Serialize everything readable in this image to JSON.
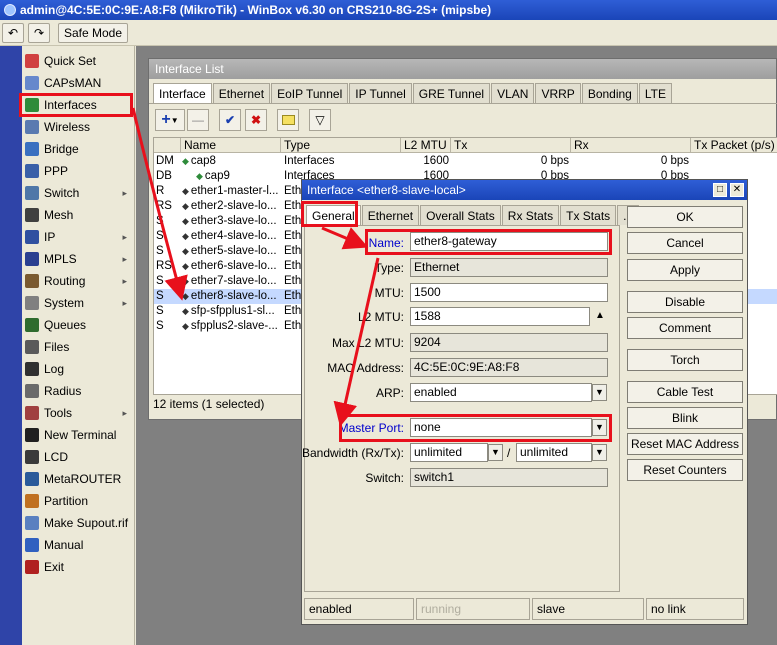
{
  "title_bar": {
    "text": "admin@4C:5E:0C:9E:A8:F8 (MikroTik) - WinBox v6.30 on CRS210-8G-2S+ (mipsbe)"
  },
  "toolbar": {
    "safe_mode": "Safe Mode"
  },
  "sidebar": {
    "items": [
      {
        "label": "Quick Set",
        "icon": "quick-set-icon"
      },
      {
        "label": "CAPsMAN",
        "icon": "capsman-icon"
      },
      {
        "label": "Interfaces",
        "icon": "interfaces-icon"
      },
      {
        "label": "Wireless",
        "icon": "wireless-icon"
      },
      {
        "label": "Bridge",
        "icon": "bridge-icon"
      },
      {
        "label": "PPP",
        "icon": "ppp-icon"
      },
      {
        "label": "Switch",
        "icon": "switch-icon",
        "submenu": true
      },
      {
        "label": "Mesh",
        "icon": "mesh-icon"
      },
      {
        "label": "IP",
        "icon": "ip-icon",
        "submenu": true
      },
      {
        "label": "MPLS",
        "icon": "mpls-icon",
        "submenu": true
      },
      {
        "label": "Routing",
        "icon": "routing-icon",
        "submenu": true
      },
      {
        "label": "System",
        "icon": "system-icon",
        "submenu": true
      },
      {
        "label": "Queues",
        "icon": "queues-icon"
      },
      {
        "label": "Files",
        "icon": "files-icon"
      },
      {
        "label": "Log",
        "icon": "log-icon"
      },
      {
        "label": "Radius",
        "icon": "radius-icon"
      },
      {
        "label": "Tools",
        "icon": "tools-icon",
        "submenu": true
      },
      {
        "label": "New Terminal",
        "icon": "terminal-icon"
      },
      {
        "label": "LCD",
        "icon": "lcd-icon"
      },
      {
        "label": "MetaROUTER",
        "icon": "metarouter-icon"
      },
      {
        "label": "Partition",
        "icon": "partition-icon"
      },
      {
        "label": "Make Supout.rif",
        "icon": "supout-icon"
      },
      {
        "label": "Manual",
        "icon": "manual-icon"
      },
      {
        "label": "Exit",
        "icon": "exit-icon"
      }
    ],
    "submenu_arrow": "▸"
  },
  "interface_list": {
    "title": "Interface List",
    "tabs": [
      "Interface",
      "Ethernet",
      "EoIP Tunnel",
      "IP Tunnel",
      "GRE Tunnel",
      "VLAN",
      "VRRP",
      "Bonding",
      "LTE"
    ],
    "columns": [
      "Name",
      "Type",
      "L2 MTU",
      "Tx",
      "Rx",
      "Tx Packet (p/s)"
    ],
    "rows": [
      {
        "flag": "DM",
        "name": "cap8",
        "type": "Interfaces",
        "l2mtu": "1600",
        "tx": "0 bps",
        "rx": "0 bps"
      },
      {
        "flag": "DB",
        "name": "cap9",
        "type": "Interfaces",
        "l2mtu": "1600",
        "tx": "0 bps",
        "rx": "0 bps"
      },
      {
        "flag": "R",
        "name": "ether1-master-l...",
        "type": "Ethe",
        "l2mtu": "",
        "tx": "",
        "rx": ""
      },
      {
        "flag": "RS",
        "name": "ether2-slave-lo...",
        "type": "Ethe",
        "l2mtu": "",
        "tx": "",
        "rx": ""
      },
      {
        "flag": "S",
        "name": "ether3-slave-lo...",
        "type": "Ethe",
        "l2mtu": "",
        "tx": "",
        "rx": ""
      },
      {
        "flag": "S",
        "name": "ether4-slave-lo...",
        "type": "Ethe",
        "l2mtu": "",
        "tx": "",
        "rx": ""
      },
      {
        "flag": "S",
        "name": "ether5-slave-lo...",
        "type": "Ethe",
        "l2mtu": "",
        "tx": "",
        "rx": ""
      },
      {
        "flag": "RS",
        "name": "ether6-slave-lo...",
        "type": "Ethe",
        "l2mtu": "",
        "tx": "",
        "rx": ""
      },
      {
        "flag": "S",
        "name": "ether7-slave-lo...",
        "type": "Ethe",
        "l2mtu": "",
        "tx": "",
        "rx": ""
      },
      {
        "flag": "S",
        "name": "ether8-slave-lo...",
        "type": "Ethe",
        "l2mtu": "",
        "tx": "",
        "rx": "",
        "selected": true
      },
      {
        "flag": "S",
        "name": "sfp-sfpplus1-sl...",
        "type": "Ethe",
        "l2mtu": "",
        "tx": "",
        "rx": ""
      },
      {
        "flag": "S",
        "name": "sfpplus2-slave-...",
        "type": "Ethe",
        "l2mtu": "",
        "tx": "",
        "rx": ""
      }
    ],
    "status": "12 items (1 selected)"
  },
  "dialog": {
    "title": "Interface <ether8-slave-local>",
    "tabs": [
      "General",
      "Ethernet",
      "Overall Stats",
      "Rx Stats",
      "Tx Stats",
      "..."
    ],
    "fields": {
      "name": {
        "label": "Name:",
        "value": "ether8-gateway"
      },
      "type": {
        "label": "Type:",
        "value": "Ethernet"
      },
      "mtu": {
        "label": "MTU:",
        "value": "1500"
      },
      "l2mtu": {
        "label": "L2 MTU:",
        "value": "1588"
      },
      "max_l2mtu": {
        "label": "Max L2 MTU:",
        "value": "9204"
      },
      "mac": {
        "label": "MAC Address:",
        "value": "4C:5E:0C:9E:A8:F8"
      },
      "arp": {
        "label": "ARP:",
        "value": "enabled"
      },
      "master_port": {
        "label": "Master Port:",
        "value": "none"
      },
      "bandwidth": {
        "label": "Bandwidth (Rx/Tx):",
        "rx": "unlimited",
        "tx": "unlimited",
        "sep": "/"
      },
      "switch": {
        "label": "Switch:",
        "value": "switch1"
      }
    },
    "buttons": [
      "OK",
      "Cancel",
      "Apply",
      "Disable",
      "Comment",
      "Torch",
      "Cable Test",
      "Blink",
      "Reset MAC Address",
      "Reset Counters"
    ],
    "status": [
      "enabled",
      "running",
      "slave",
      "no link"
    ]
  },
  "colors": {
    "highlight": "#e8101c",
    "titlebar": "#1a45b8",
    "workspace": "#808080",
    "label_blue": "#0000cc"
  }
}
